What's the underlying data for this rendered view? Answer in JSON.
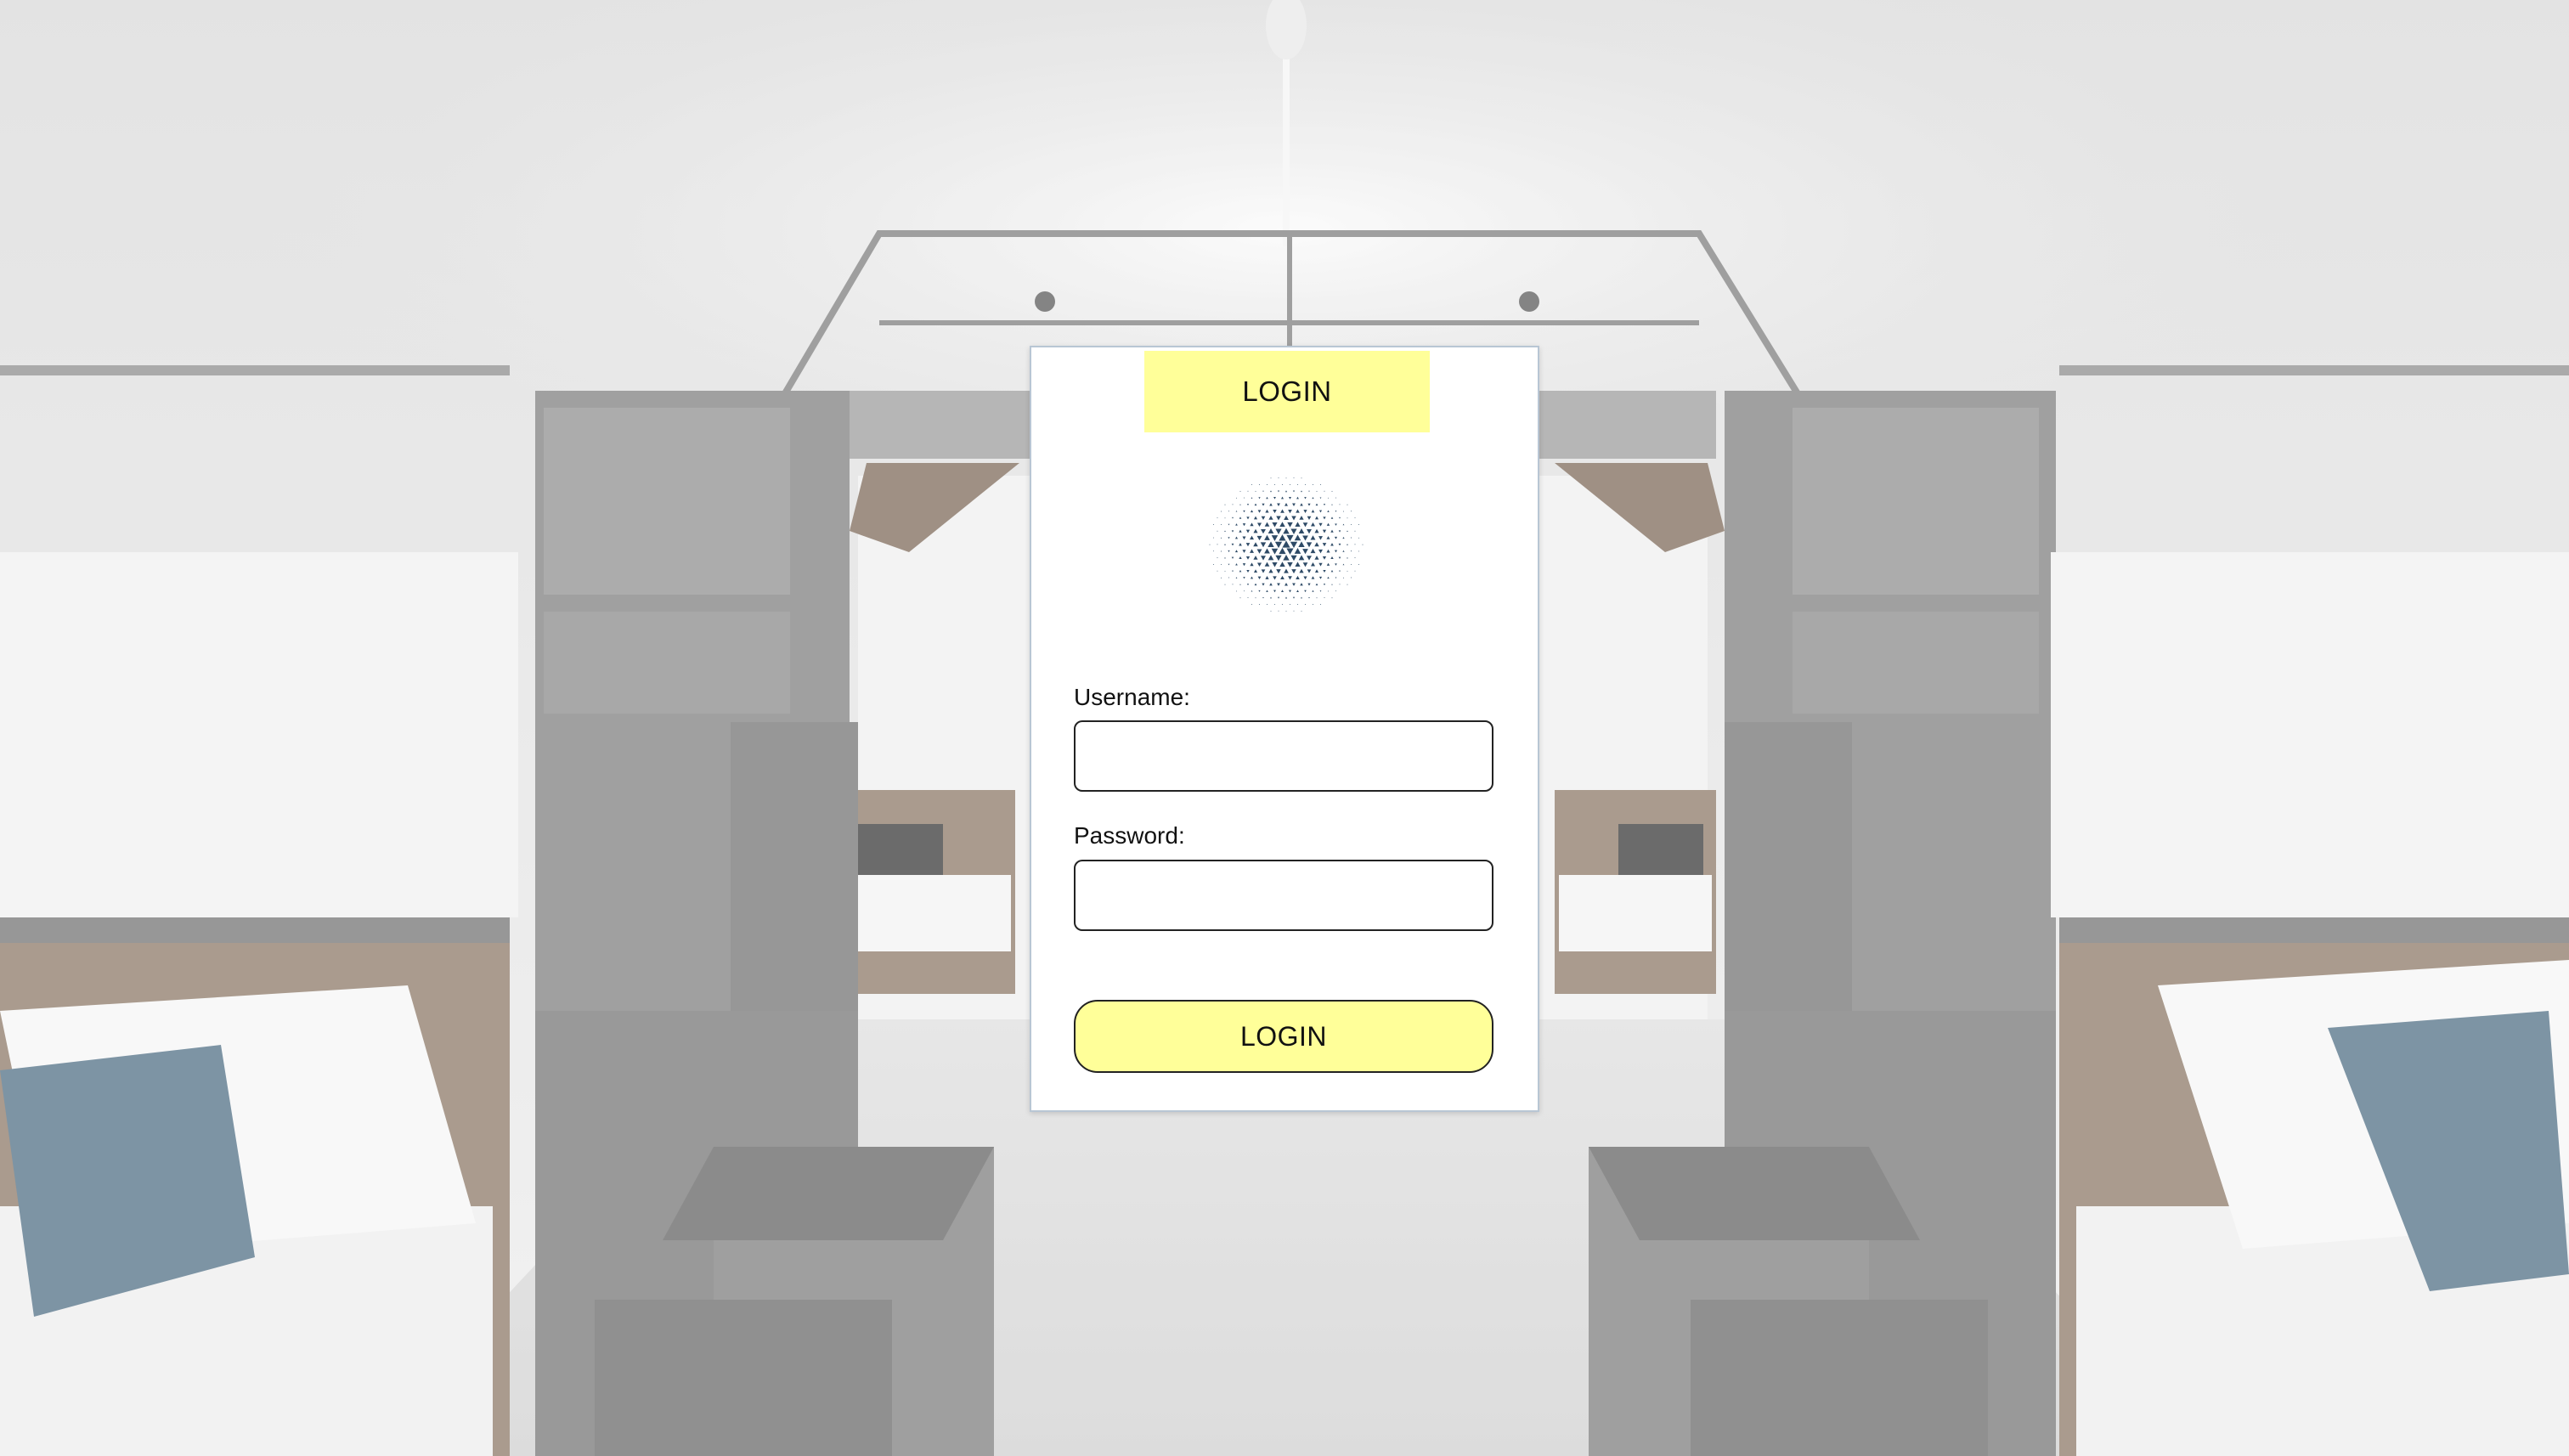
{
  "colors": {
    "accent": "#ffff99",
    "card_background": "#ffffff",
    "card_border": "#b8c6d4",
    "logo": "#2e4a66"
  },
  "login_card": {
    "header_tab": "LOGIN",
    "logo_icon": "hexagon-triangle-pattern-logo",
    "username_label": "Username:",
    "username_value": "",
    "password_label": "Password:",
    "password_value": "",
    "submit_label": "LOGIN"
  },
  "background": {
    "description_icon": "hostel-bunk-room-photo"
  }
}
